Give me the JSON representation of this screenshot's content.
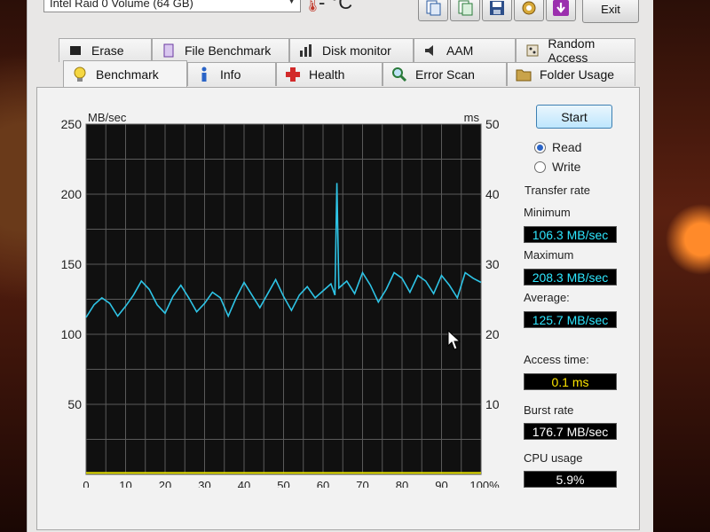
{
  "title_bar": {
    "drive_select_value": "Intel Raid 0 Volume (64 GB)",
    "temperature_label": "- °C",
    "exit_label": "Exit"
  },
  "tabs_row1": [
    {
      "label": "Erase",
      "icon": "eraser-icon"
    },
    {
      "label": "File Benchmark",
      "icon": "file-benchmark-icon"
    },
    {
      "label": "Disk monitor",
      "icon": "bar-chart-icon"
    },
    {
      "label": "AAM",
      "icon": "speaker-icon"
    },
    {
      "label": "Random Access",
      "icon": "random-access-icon"
    }
  ],
  "tabs_row2": [
    {
      "label": "Benchmark",
      "icon": "lightbulb-icon",
      "active": true
    },
    {
      "label": "Info",
      "icon": "info-icon"
    },
    {
      "label": "Health",
      "icon": "health-cross-icon"
    },
    {
      "label": "Error Scan",
      "icon": "magnifier-icon"
    },
    {
      "label": "Folder Usage",
      "icon": "folder-icon"
    }
  ],
  "controls": {
    "start_label": "Start",
    "read_label": "Read",
    "write_label": "Write",
    "selected_mode": "Read"
  },
  "results": {
    "transfer_rate_label": "Transfer rate",
    "minimum_label": "Minimum",
    "minimum_value": "106.3 MB/sec",
    "maximum_label": "Maximum",
    "maximum_value": "208.3 MB/sec",
    "average_label": "Average:",
    "average_value": "125.7 MB/sec",
    "access_time_label": "Access time:",
    "access_time_value": "0.1 ms",
    "burst_rate_label": "Burst rate",
    "burst_rate_value": "176.7 MB/sec",
    "cpu_usage_label": "CPU usage",
    "cpu_usage_value": "5.9%"
  },
  "chart_data": {
    "type": "line",
    "y_left_unit": "MB/sec",
    "y_right_unit": "ms",
    "ylim_left": [
      0,
      250
    ],
    "ylim_right": [
      0,
      50
    ],
    "xlim": [
      0,
      100
    ],
    "y_left_ticks": [
      "250",
      "200",
      "150",
      "100",
      "50"
    ],
    "y_right_ticks": [
      "50",
      "40",
      "30",
      "20",
      "10"
    ],
    "x_ticks": [
      "0",
      "10",
      "20",
      "30",
      "40",
      "50",
      "60",
      "70",
      "80",
      "90",
      "100%"
    ],
    "grid": true,
    "series": [
      {
        "color": "#2ec4e6",
        "x": [
          0,
          2,
          4,
          6,
          8,
          10,
          12,
          14,
          16,
          18,
          20,
          22,
          24,
          26,
          28,
          30,
          32,
          34,
          36,
          38,
          40,
          42,
          44,
          46,
          48,
          50,
          52,
          54,
          56,
          58,
          60,
          62,
          63,
          63.5,
          64,
          66,
          68,
          70,
          72,
          74,
          76,
          78,
          80,
          82,
          84,
          86,
          88,
          90,
          92,
          94,
          96,
          98,
          100
        ],
        "y": [
          112,
          121,
          126,
          122,
          113,
          120,
          128,
          138,
          132,
          121,
          115,
          127,
          135,
          126,
          116,
          122,
          130,
          126,
          113,
          126,
          137,
          128,
          119,
          129,
          139,
          127,
          117,
          128,
          134,
          126,
          131,
          136,
          128,
          208,
          133,
          138,
          129,
          144,
          135,
          123,
          132,
          144,
          140,
          130,
          142,
          138,
          129,
          142,
          135,
          126,
          144,
          140,
          137
        ]
      },
      {
        "color": "#e8e200",
        "x": [
          0,
          100
        ],
        "y": [
          1,
          1
        ]
      }
    ]
  }
}
